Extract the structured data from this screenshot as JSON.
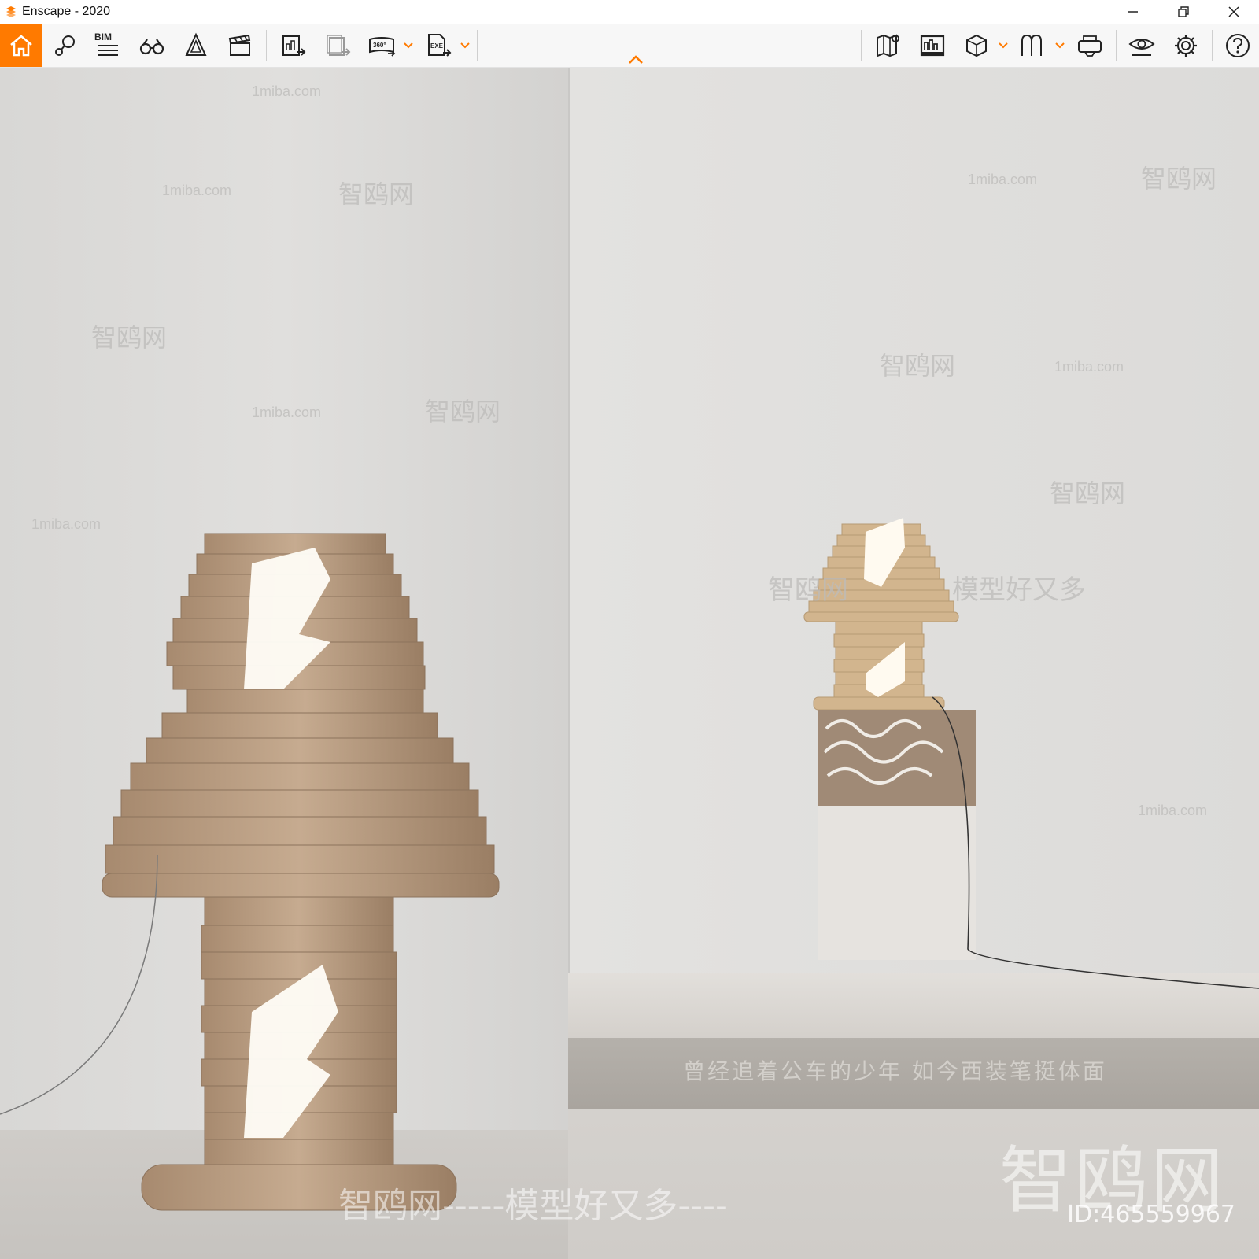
{
  "window": {
    "title": "Enscape - 2020",
    "controls": [
      "minimize",
      "restore",
      "close"
    ]
  },
  "toolbar": {
    "bim_label": "BIM",
    "pano_label": "360°",
    "exe_label": "EXE",
    "accent_color": "#ff7a00",
    "left_tools": [
      "home-icon",
      "pin-map-icon",
      "bim-list-icon",
      "binoculars-icon",
      "cone-icon",
      "clapper-icon",
      "export-image-icon",
      "batch-render-icon",
      "panorama-icon",
      "exe-export-icon"
    ],
    "right_tools": [
      "map-icon",
      "asset-library-icon",
      "cube-icon",
      "visual-settings-icon",
      "vr-headset-icon",
      "eye-icon",
      "gear-icon",
      "help-icon"
    ]
  },
  "viewport": {
    "caption": "曾经追着公车的少年 如今西装笔挺体面",
    "watermarks": {
      "site": "1miba.com",
      "brand": "智鸥网",
      "slogan": "模型好又多",
      "big": "智鸥网",
      "id": "ID:465559967",
      "bottom": "智鸥网-----模型好又多----"
    }
  }
}
